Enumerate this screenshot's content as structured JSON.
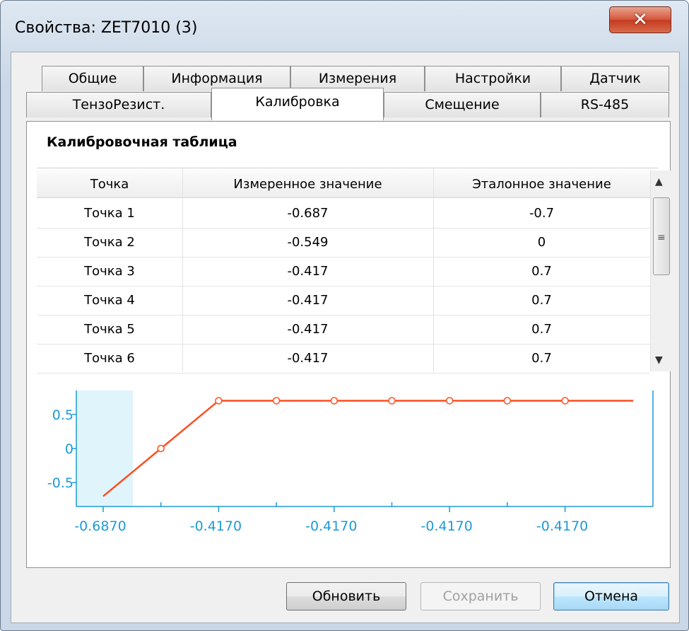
{
  "window": {
    "title": "Свойства: ZET7010 (3)",
    "close_glyph": "✕"
  },
  "tabs_row1": [
    "Общие",
    "Информация",
    "Измерения",
    "Настройки",
    "Датчик"
  ],
  "tabs_row2": [
    "ТензоРезист.",
    "Калибровка",
    "Смещение",
    "RS-485"
  ],
  "active_tab": "Калибровка",
  "section_title": "Калибровочная таблица",
  "table": {
    "columns": [
      "Точка",
      "Измеренное значение",
      "Эталонное значение"
    ],
    "rows": [
      [
        "Точка 1",
        "-0.687",
        "-0.7"
      ],
      [
        "Точка 2",
        "-0.549",
        "0"
      ],
      [
        "Точка 3",
        "-0.417",
        "0.7"
      ],
      [
        "Точка 4",
        "-0.417",
        "0.7"
      ],
      [
        "Точка 5",
        "-0.417",
        "0.7"
      ],
      [
        "Точка 6",
        "-0.417",
        "0.7"
      ]
    ]
  },
  "chart_data": {
    "type": "line",
    "x_tick_labels": [
      "-0.6870",
      "-0.4170",
      "-0.4170",
      "-0.4170",
      "-0.4170"
    ],
    "y_tick_labels": [
      "0.5",
      "0",
      "-0.5"
    ],
    "ylim": [
      -0.85,
      0.85
    ],
    "series": [
      {
        "values": [
          -0.7,
          0,
          0.7,
          0.7,
          0.7,
          0.7,
          0.7,
          0.7,
          0.7
        ]
      }
    ],
    "line_color": "#ff4d1f",
    "axis_color": "#1e9ad6",
    "highlight_color": "#dff4fb"
  },
  "buttons": {
    "refresh": "Обновить",
    "save": "Сохранить",
    "cancel": "Отмена"
  }
}
